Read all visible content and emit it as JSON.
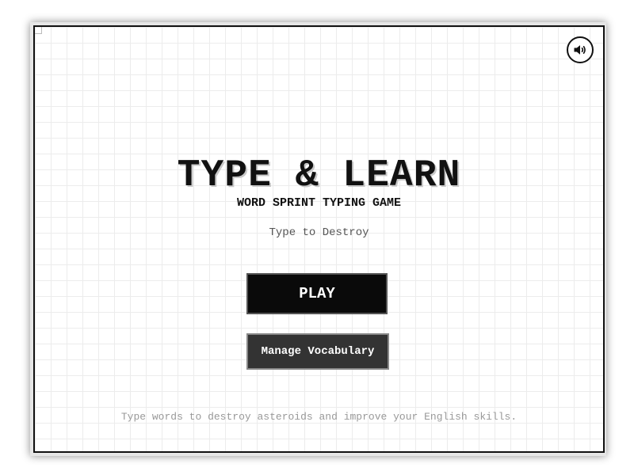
{
  "game": {
    "title": "TYPE & LEARN",
    "subtitle": "WORD SPRINT TYPING GAME",
    "tagline": "Type to Destroy",
    "footer": "Type words to destroy asteroids and improve your English skills."
  },
  "buttons": {
    "play_label": "PLAY",
    "vocab_label": "Manage Vocabulary"
  },
  "controls": {
    "sound_icon": "speaker-volume-icon"
  },
  "colors": {
    "ink": "#111111",
    "primary_button": "#0a0a0a",
    "secondary_button": "#333333",
    "grid_line": "#ececec"
  }
}
